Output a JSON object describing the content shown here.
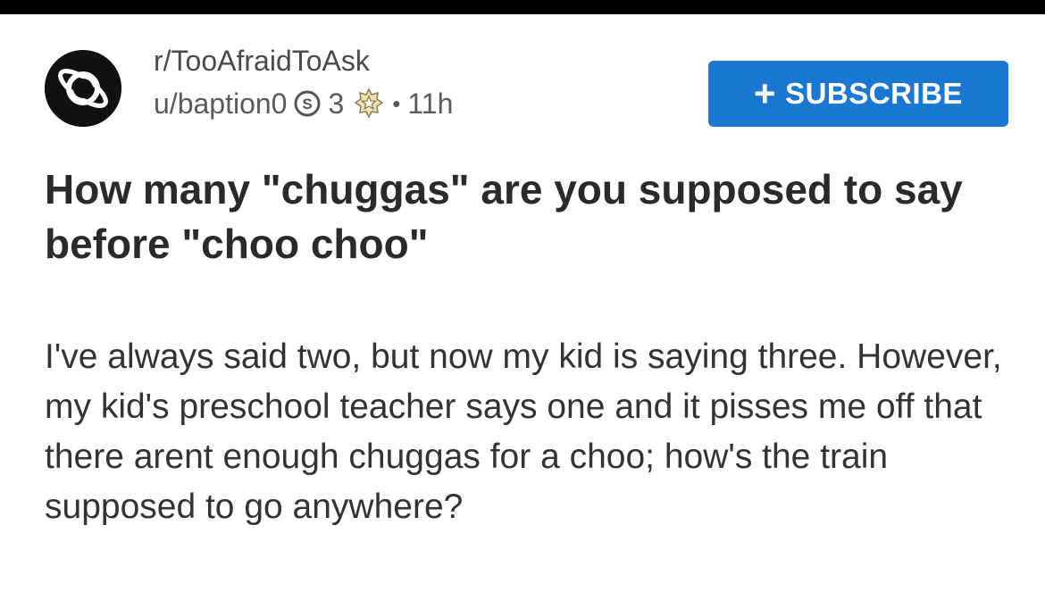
{
  "colors": {
    "subscribe_bg": "#1a77d2",
    "header_bar": "#000000",
    "text_primary": "#2a2a2a",
    "text_meta": "#5a5a5a"
  },
  "post": {
    "subreddit": "r/TooAfraidToAsk",
    "author": "u/baption0",
    "karma_icon": "coin-s-icon",
    "karma_count": "3",
    "award_icon": "star-award-icon",
    "separator": "•",
    "age": "11h",
    "subscribe_label": "SUBSCRIBE",
    "subscribe_icon": "plus-icon",
    "title": "How many \"chuggas\" are you supposed to say before \"choo choo\"",
    "body": "I've always said two, but now my kid is saying three. However, my kid's preschool teacher says one and it pisses me off that there arent enough chuggas for a choo; how's the train supposed to go anywhere?"
  }
}
